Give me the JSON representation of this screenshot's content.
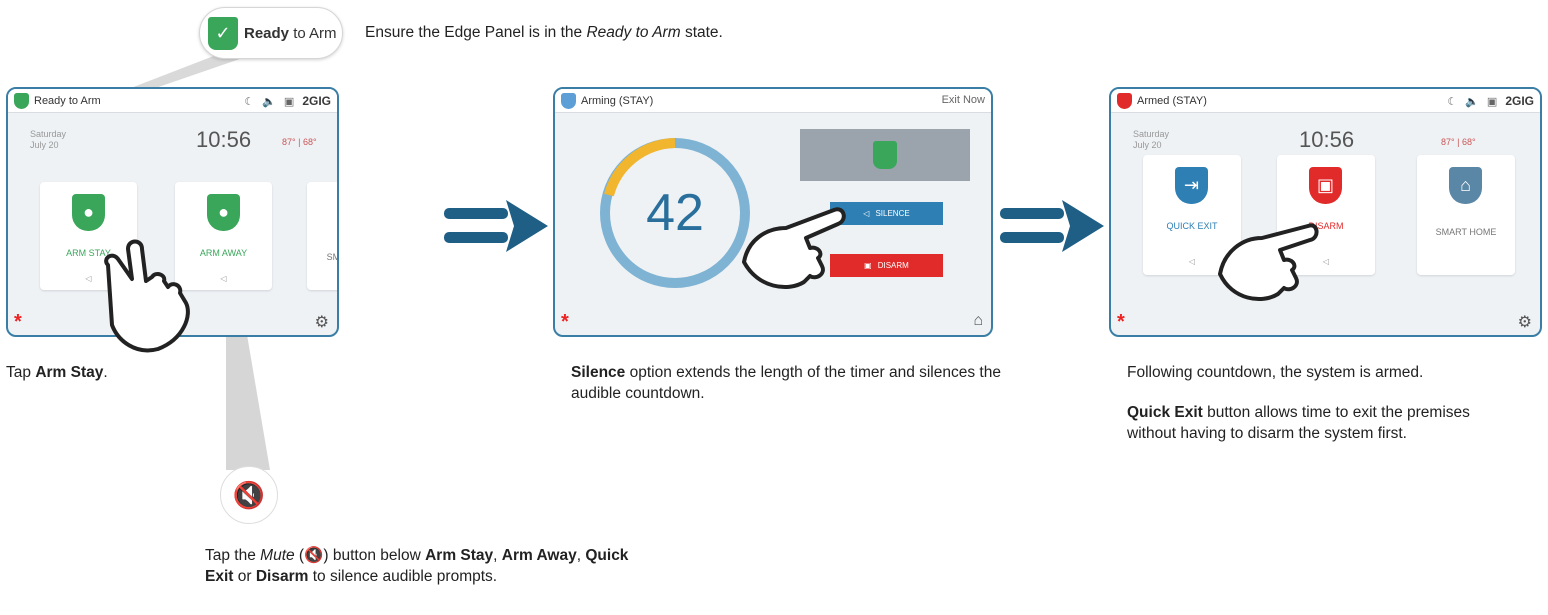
{
  "callout": {
    "ready_bold": "Ready",
    "ready_light": "to Arm",
    "instruction_pre": "Ensure the Edge Panel is in the ",
    "instruction_em": "Ready to Arm",
    "instruction_post": " state."
  },
  "panel1": {
    "status": "Ready to Arm",
    "brand": "2GIG",
    "date_day": "Saturday",
    "date_md": "July 20",
    "time": "10:56",
    "temp": "87° | 68°",
    "tiles": [
      {
        "label": "ARM STAY",
        "color": "#3aa65a"
      },
      {
        "label": "ARM AWAY",
        "color": "#3aa65a"
      },
      {
        "label": "SMART HOME",
        "color": "#5a87a6"
      }
    ]
  },
  "panel2": {
    "status": "Arming (STAY)",
    "exit_now": "Exit Now",
    "countdown": "42",
    "silence": "SILENCE",
    "disarm": "DISARM"
  },
  "panel3": {
    "status": "Armed (STAY)",
    "brand": "2GIG",
    "date_day": "Saturday",
    "date_md": "July 20",
    "time": "10:56",
    "temp": "87° | 68°",
    "tiles": [
      {
        "label": "QUICK EXIT",
        "color": "#2e7fb4"
      },
      {
        "label": "DISARM",
        "color": "#e12b2b"
      },
      {
        "label": "SMART HOME",
        "color": "#5a87a6"
      }
    ]
  },
  "captions": {
    "tap_pre": "Tap ",
    "tap_bold": "Arm Stay",
    "tap_post": ".",
    "silence_bold": "Silence",
    "silence_rest": " option extends the length of the timer and silences the audible countdown.",
    "armed_line": "Following countdown, the system is armed.",
    "quick_bold": "Quick Exit",
    "quick_rest": " button allows time to exit the premises without having to disarm the system first.",
    "mute_pre": "Tap the ",
    "mute_em": "Mute",
    "mute_mid": " button below ",
    "mute_b1": "Arm Stay",
    "mute_c1": ", ",
    "mute_b2": "Arm Away",
    "mute_c2": ", ",
    "mute_b3": "Quick Exit",
    "mute_or": " or ",
    "mute_b4": "Disarm",
    "mute_end": " to silence audible prompts."
  },
  "colors": {
    "frame": "#3a7ea5",
    "arrow": "#1f5f86",
    "green": "#3aa65a",
    "red": "#e12b2b",
    "blue": "#2e7fb4"
  }
}
